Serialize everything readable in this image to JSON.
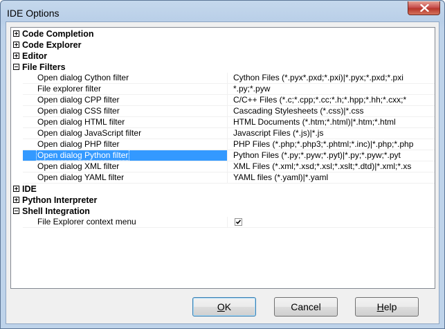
{
  "window": {
    "title": "IDE Options"
  },
  "categories": [
    {
      "label": "Code Completion",
      "expanded": false,
      "items": []
    },
    {
      "label": "Code Explorer",
      "expanded": false,
      "items": []
    },
    {
      "label": "Editor",
      "expanded": false,
      "items": []
    },
    {
      "label": "File Filters",
      "expanded": true,
      "items": [
        {
          "name": "Open dialog Cython filter",
          "value": "Cython Files (*.pyx*.pxd;*.pxi)|*.pyx;*.pxd;*.pxi"
        },
        {
          "name": "File explorer filter",
          "value": "*.py;*.pyw"
        },
        {
          "name": "Open dialog CPP filter",
          "value": "C/C++ Files (*.c;*.cpp;*.cc;*.h;*.hpp;*.hh;*.cxx;*"
        },
        {
          "name": "Open dialog CSS filter",
          "value": "Cascading Stylesheets (*.css)|*.css"
        },
        {
          "name": "Open dialog HTML filter",
          "value": "HTML Documents (*.htm;*.html)|*.htm;*.html"
        },
        {
          "name": "Open dialog JavaScript filter",
          "value": "Javascript Files (*.js)|*.js"
        },
        {
          "name": "Open dialog PHP filter",
          "value": "PHP Files (*.php;*.php3;*.phtml;*.inc)|*.php;*.php"
        },
        {
          "name": "Open dialog Python filter",
          "value": "Python Files (*.py;*.pyw;*.pyt)|*.py;*.pyw;*.pyt",
          "selected": true
        },
        {
          "name": "Open dialog XML filter",
          "value": "XML Files (*.xml;*.xsd;*.xsl;*.xslt;*.dtd)|*.xml;*.xs"
        },
        {
          "name": "Open dialog YAML filter",
          "value": "YAML files (*.yaml)|*.yaml"
        }
      ]
    },
    {
      "label": "IDE",
      "expanded": false,
      "items": []
    },
    {
      "label": "Python Interpreter",
      "expanded": false,
      "items": []
    },
    {
      "label": "Shell Integration",
      "expanded": true,
      "items": [
        {
          "name": "File Explorer context menu",
          "checkbox": true,
          "checked": true
        }
      ]
    }
  ],
  "buttons": {
    "ok": {
      "accel": "O",
      "rest": "K"
    },
    "cancel": {
      "label": "Cancel"
    },
    "help": {
      "accel": "H",
      "rest": "elp"
    }
  },
  "icons": {
    "close": "close-icon",
    "expand": "plus-icon",
    "collapse": "minus-icon",
    "check": "checkmark-icon"
  },
  "colors": {
    "selection": "#3399ff",
    "grid_line": "#f0f0f0",
    "close_button": "#c75050"
  }
}
